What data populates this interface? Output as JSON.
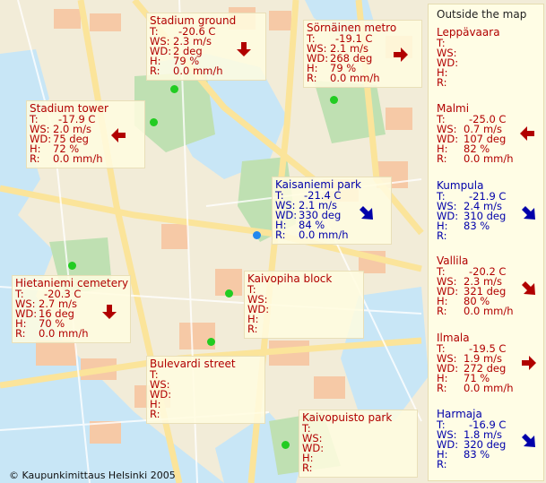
{
  "map": {
    "copyright": "© Kaupunkimittaus Helsinki 2005",
    "colors": {
      "water": "#c8e6f6",
      "land": "#f2ecd8",
      "park": "#bfe0b2",
      "road": "#fbe49a",
      "block": "#f6c9a6",
      "box": "#fffde5"
    }
  },
  "labels": {
    "T": "T:",
    "WS": "WS:",
    "WD": "WD:",
    "H": "H:",
    "R": "R:"
  },
  "stations": [
    {
      "id": "stadium-ground",
      "name": "Stadium ground",
      "T": "-20.6 C",
      "WS": "2.3 m/s",
      "WD": "2 deg",
      "H": "79 %",
      "R": "0.0 mm/h",
      "color": "#b10000",
      "arrow": "down"
    },
    {
      "id": "sornainen-metro",
      "name": "Sörnäinen metro",
      "T": "-19.1 C",
      "WS": "2.1 m/s",
      "WD": "268 deg",
      "H": "79 %",
      "R": "0.0 mm/h",
      "color": "#b10000",
      "arrow": "right"
    },
    {
      "id": "stadium-tower",
      "name": "Stadium tower",
      "T": "-17.9 C",
      "WS": "2.0 m/s",
      "WD": "75 deg",
      "H": "72 %",
      "R": "0.0 mm/h",
      "color": "#b10000",
      "arrow": "left"
    },
    {
      "id": "kaisaniemi-park",
      "name": "Kaisaniemi park",
      "T": "-21.4 C",
      "WS": "2.1 m/s",
      "WD": "330 deg",
      "H": "84 %",
      "R": "0.0 mm/h",
      "color": "#0000aa",
      "arrow": "down-right"
    },
    {
      "id": "hietaniemi-cemetery",
      "name": "Hietaniemi cemetery",
      "T": "-20.3 C",
      "WS": "2.7 m/s",
      "WD": "16 deg",
      "H": "70 %",
      "R": "0.0 mm/h",
      "color": "#b10000",
      "arrow": "down"
    },
    {
      "id": "kaivopiha-block",
      "name": "Kaivopiha block",
      "T": "",
      "WS": "",
      "WD": "",
      "H": "",
      "R": "",
      "color": "#b10000",
      "arrow": ""
    },
    {
      "id": "bulevardi-street",
      "name": "Bulevardi street",
      "T": "",
      "WS": "",
      "WD": "",
      "H": "",
      "R": "",
      "color": "#b10000",
      "arrow": ""
    },
    {
      "id": "kaivopuisto-park",
      "name": "Kaivopuisto park",
      "T": "",
      "WS": "",
      "WD": "",
      "H": "",
      "R": "",
      "color": "#b10000",
      "arrow": ""
    }
  ],
  "outside": {
    "title": "Outside the map",
    "stations": [
      {
        "id": "leppavaara",
        "name": "Leppävaara",
        "T": "",
        "WS": "",
        "WD": "",
        "H": "",
        "R": "",
        "color": "#b10000",
        "arrow": ""
      },
      {
        "id": "malmi",
        "name": "Malmi",
        "T": "-25.0 C",
        "WS": "0.7 m/s",
        "WD": "107 deg",
        "H": "82 %",
        "R": "0.0 mm/h",
        "color": "#b10000",
        "arrow": "left"
      },
      {
        "id": "kumpula",
        "name": "Kumpula",
        "T": "-21.9 C",
        "WS": "2.4 m/s",
        "WD": "310 deg",
        "H": "83 %",
        "R": "",
        "color": "#0000aa",
        "arrow": "down-right"
      },
      {
        "id": "vallila",
        "name": "Vallila",
        "T": "-20.2 C",
        "WS": "2.3 m/s",
        "WD": "321 deg",
        "H": "80 %",
        "R": "0.0 mm/h",
        "color": "#b10000",
        "arrow": "down-right"
      },
      {
        "id": "ilmala",
        "name": "Ilmala",
        "T": "-19.5 C",
        "WS": "1.9 m/s",
        "WD": "272 deg",
        "H": "71 %",
        "R": "0.0 mm/h",
        "color": "#b10000",
        "arrow": "right"
      },
      {
        "id": "harmaja",
        "name": "Harmaja",
        "T": "-16.9 C",
        "WS": "1.8 m/s",
        "WD": "320 deg",
        "H": "83 %",
        "R": "",
        "color": "#0000aa",
        "arrow": "down-right"
      }
    ]
  }
}
